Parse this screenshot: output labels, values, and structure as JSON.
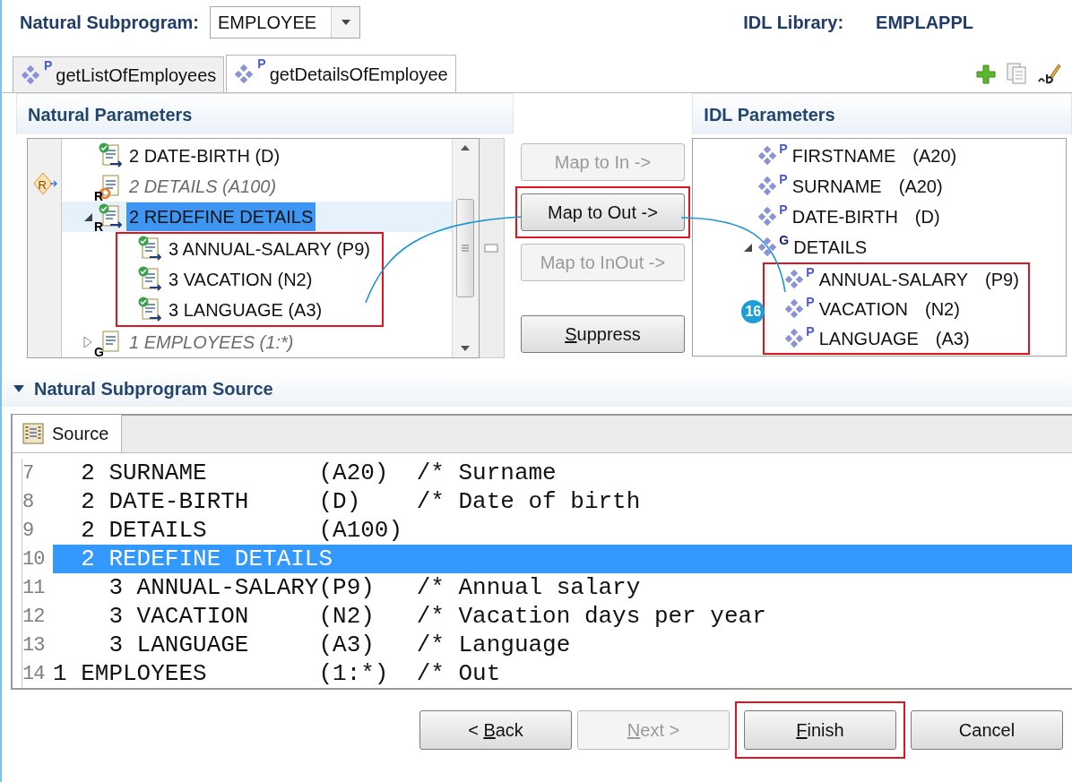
{
  "header": {
    "subprogram_label": "Natural Subprogram:",
    "subprogram": "EMPLOYEE",
    "library_label": "IDL Library:",
    "library": "EMPLAPPL"
  },
  "tabs": [
    {
      "label": "getListOfEmployees",
      "marker": "P",
      "selected": false
    },
    {
      "label": "getDetailsOfEmployee",
      "marker": "P",
      "selected": true
    }
  ],
  "natural_parameters": {
    "title": "Natural Parameters",
    "gutter_marker": "R",
    "tree": [
      {
        "children": [
          {
            "label": "2 DATE-BIRTH (D)",
            "kind": "mapped",
            "inactive": false,
            "selected": false
          },
          {
            "label": "2 DETAILS (A100)",
            "kind": "redefined",
            "marker": "R",
            "inactive": true,
            "selected": false
          },
          {
            "label": "2 REDEFINE DETAILS",
            "kind": "mapped",
            "marker": "R",
            "inactive": false,
            "selected": true,
            "expanded": true,
            "highlighted": true,
            "children": [
              {
                "label": "3 ANNUAL-SALARY (P9)",
                "kind": "mapped",
                "inactive": false,
                "selected": false
              },
              {
                "label": "3 VACATION (N2)",
                "kind": "mapped",
                "inactive": false,
                "selected": false
              },
              {
                "label": "3 LANGUAGE (A3)",
                "kind": "mapped",
                "inactive": false,
                "selected": false
              }
            ]
          }
        ]
      },
      {
        "label": "1 EMPLOYEES (1:*)",
        "kind": "plain",
        "marker": "G",
        "inactive": true,
        "selected": false,
        "expanded": false
      }
    ]
  },
  "mapping_buttons": [
    {
      "label": "Map to In ->",
      "disabled": true,
      "highlighted": false
    },
    {
      "label": "Map to Out ->",
      "disabled": false,
      "highlighted": true
    },
    {
      "label": "Map to InOut ->",
      "disabled": true,
      "highlighted": false
    },
    {
      "disabled": false,
      "highlighted": false,
      "label_parts": {
        "key": "S",
        "after": "uppress"
      }
    }
  ],
  "idl_parameters": {
    "title": "IDL Parameters",
    "tree": [
      {
        "name": "FIRSTNAME",
        "type": "(A20)",
        "marker": "P"
      },
      {
        "name": "SURNAME",
        "type": "(A20)",
        "marker": "P"
      },
      {
        "name": "DATE-BIRTH",
        "type": "(D)",
        "marker": "P"
      },
      {
        "name": "DETAILS",
        "marker": "G",
        "expanded": true,
        "highlighted": true,
        "children": [
          {
            "name": "ANNUAL-SALARY",
            "type": "(P9)",
            "marker": "P"
          },
          {
            "name": "VACATION",
            "type": "(N2)",
            "marker": "P",
            "callout": "16"
          },
          {
            "name": "LANGUAGE",
            "type": "(A3)",
            "marker": "P"
          }
        ]
      }
    ]
  },
  "source_section": {
    "title": "Natural Subprogram Source",
    "expanded": true,
    "tab": "Source",
    "lines": [
      {
        "number": "7",
        "text": "  2 SURNAME        (A20)  /* Surname",
        "selected": false
      },
      {
        "number": "8",
        "text": "  2 DATE-BIRTH     (D)    /* Date of birth",
        "selected": false
      },
      {
        "number": "9",
        "text": "  2 DETAILS        (A100)",
        "selected": false
      },
      {
        "number": "10",
        "text": "  2 REDEFINE DETAILS",
        "selected": true
      },
      {
        "number": "11",
        "text": "    3 ANNUAL-SALARY(P9)   /* Annual salary",
        "selected": false
      },
      {
        "number": "12",
        "text": "    3 VACATION     (N2)   /* Vacation days per year",
        "selected": false
      },
      {
        "number": "13",
        "text": "    3 LANGUAGE     (A3)   /* Language",
        "selected": false
      },
      {
        "number": "14",
        "text": "1 EMPLOYEES        (1:*)  /* Out",
        "selected": false
      }
    ]
  },
  "footer_buttons": [
    {
      "label_parts": {
        "before": "< ",
        "key": "B",
        "after": "ack"
      },
      "disabled": false,
      "highlighted": false
    },
    {
      "label_parts": {
        "key": "N",
        "after": "ext >"
      },
      "disabled": true,
      "highlighted": false
    },
    {
      "label_parts": {
        "key": "F",
        "after": "inish"
      },
      "disabled": false,
      "highlighted": true
    },
    {
      "label": "Cancel",
      "disabled": false,
      "highlighted": false
    }
  ]
}
